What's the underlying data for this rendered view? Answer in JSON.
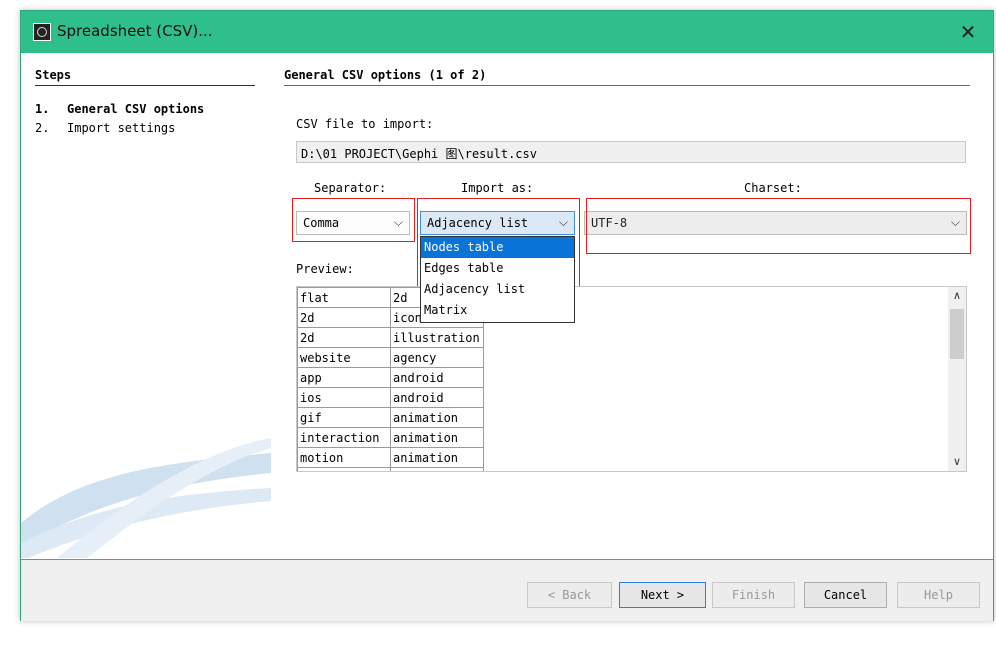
{
  "window": {
    "title": "Spreadsheet (CSV)...",
    "close_glyph": "✕",
    "icon": "app-icon"
  },
  "steps": {
    "heading": "Steps",
    "items": [
      {
        "num": "1.",
        "label": "General CSV options"
      },
      {
        "num": "2.",
        "label": "Import settings"
      }
    ]
  },
  "content": {
    "heading": "General CSV options (1 of 2)",
    "file_label": "CSV file to import:",
    "file_path": "D:\\01 PROJECT\\Gephi 图\\result.csv",
    "separator_label": "Separator:",
    "import_as_label": "Import as:",
    "charset_label": "Charset:",
    "separator_value": "Comma",
    "import_as_value": "Adjacency list",
    "charset_value": "UTF-8",
    "import_as_options": [
      "Nodes table",
      "Edges table",
      "Adjacency list",
      "Matrix"
    ],
    "import_as_highlighted": "Nodes table",
    "preview_label": "Preview:",
    "preview_rows": [
      [
        "flat",
        "2d"
      ],
      [
        "2d",
        "icon"
      ],
      [
        "2d",
        "illustration"
      ],
      [
        "website",
        "agency"
      ],
      [
        "app",
        "android"
      ],
      [
        "ios",
        "android"
      ],
      [
        "gif",
        "animation"
      ],
      [
        "interaction",
        "animation"
      ],
      [
        "motion",
        "animation"
      ],
      [
        "",
        ""
      ]
    ]
  },
  "footer": {
    "back": "< Back",
    "next": "Next >",
    "finish": "Finish",
    "cancel": "Cancel",
    "help": "Help"
  },
  "colors": {
    "titlebar": "#2fbf8a",
    "highlight_box": "#dd2222",
    "selection": "#0a73d8"
  }
}
